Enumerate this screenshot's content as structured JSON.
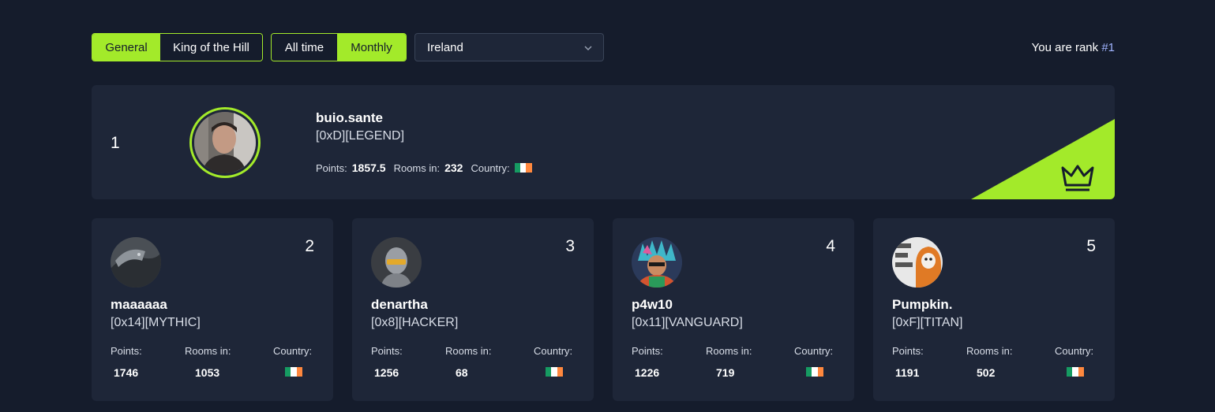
{
  "filters": {
    "type_tabs": [
      {
        "label": "General",
        "active": true
      },
      {
        "label": "King of the Hill",
        "active": false
      }
    ],
    "period_tabs": [
      {
        "label": "All time",
        "active": false
      },
      {
        "label": "Monthly",
        "active": true
      }
    ],
    "country_select": {
      "value": "Ireland"
    }
  },
  "rank_info": {
    "prefix": "You are rank",
    "rank": "#1"
  },
  "labels": {
    "points": "Points:",
    "rooms": "Rooms in:",
    "country": "Country:"
  },
  "colors": {
    "accent": "#a3ea2a",
    "background": "#151c2c",
    "card": "#1e2638",
    "link": "#a0b4ff",
    "flag_ireland": [
      "#169b62",
      "#ffffff",
      "#ff883e"
    ]
  },
  "leader": {
    "position": "1",
    "username": "buio.sante",
    "tag": "[0xD][LEGEND]",
    "points": "1857.5",
    "rooms": "232",
    "country_flag": "ireland-flag",
    "badge_icon": "crown-icon"
  },
  "runners": [
    {
      "position": "2",
      "username": "maaaaaa",
      "tag": "[0x14][MYTHIC]",
      "points": "1746",
      "rooms": "1053",
      "country_flag": "ireland-flag"
    },
    {
      "position": "3",
      "username": "denartha",
      "tag": "[0x8][HACKER]",
      "points": "1256",
      "rooms": "68",
      "country_flag": "ireland-flag"
    },
    {
      "position": "4",
      "username": "p4w10",
      "tag": "[0x11][VANGUARD]",
      "points": "1226",
      "rooms": "719",
      "country_flag": "ireland-flag"
    },
    {
      "position": "5",
      "username": "Pumpkin.",
      "tag": "[0xF][TITAN]",
      "points": "1191",
      "rooms": "502",
      "country_flag": "ireland-flag"
    }
  ]
}
